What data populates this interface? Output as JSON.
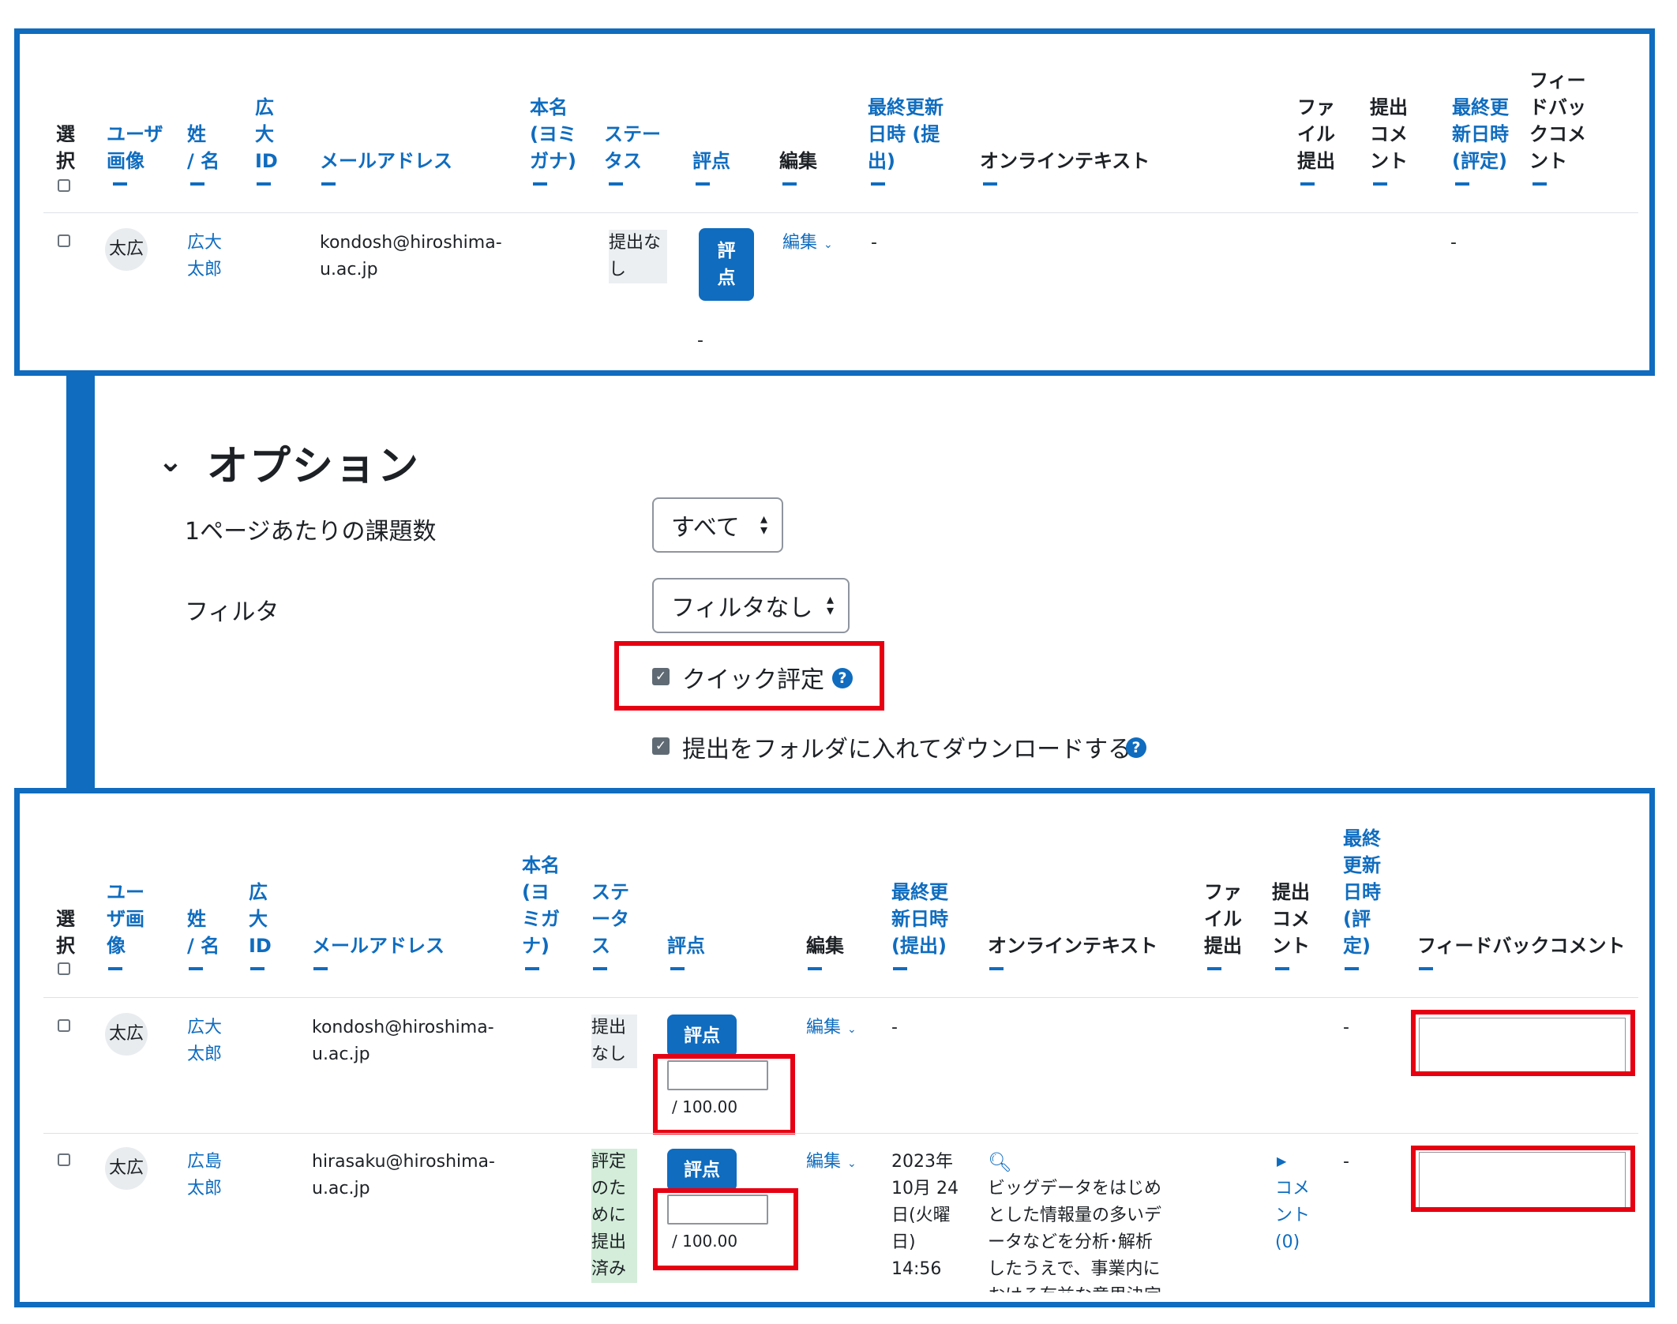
{
  "colors": {
    "frame_blue": "#0f6cbf",
    "highlight_red": "#e60012"
  },
  "top_table": {
    "headers": {
      "select": "選\n択",
      "user_image": "ユーザ\n画像",
      "name": "姓\n/ 名",
      "hiroshima_id": "広\n大\nID",
      "email": "メールアドレス",
      "real_name": "本名\n(ヨミ\nガナ)",
      "status": "ステー\nタス",
      "grade": "評点",
      "edit": "編集",
      "last_modified_submission": "最終更新\n日時 (提\n出)",
      "online_text": "オンラインテキスト",
      "file_submission": "ファ\nイル\n提出",
      "submission_comments": "提出\nコメ\nント",
      "last_modified_grade": "最終更\n新日時\n(評定)",
      "feedback_comment": "フィー\nドバッ\nクコメ\nント"
    },
    "row": {
      "avatar": "太広",
      "name": "広大\n太郎",
      "email": "kondosh@hiroshima-\nu.ac.jp",
      "status": "提出な\nし",
      "grade_button": "評\n点",
      "grade_value": "-",
      "edit": "編集",
      "last_modified": "-",
      "last_modified_grade": "-"
    }
  },
  "options": {
    "title": "オプション",
    "per_page_label": "1ページあたりの課題数",
    "per_page_value": "すべて",
    "filter_label": "フィルタ",
    "filter_value": "フィルタなし",
    "quick_grading_label": "クイック評定",
    "quick_grading_checked": true,
    "download_folders_label": "提出をフォルダに入れてダウンロードする",
    "download_folders_checked": true
  },
  "bottom_table": {
    "headers": {
      "select": "選\n択",
      "user_image": "ユー\nザ画\n像",
      "name": "姓\n/ 名",
      "hiroshima_id": "広\n大\nID",
      "email": "メールアドレス",
      "real_name": "本名\n(ヨ\nミガ\nナ)",
      "status": "ステ\nータ\nス",
      "grade": "評点",
      "edit": "編集",
      "last_modified_submission": "最終更\n新日時\n(提出)",
      "online_text": "オンラインテキスト",
      "file_submission": "ファ\nイル\n提出",
      "submission_comments": "提出\nコメ\nント",
      "last_modified_grade": "最終\n更新\n日時\n(評\n定)",
      "feedback_comment": "フィードバックコメント"
    },
    "rows": [
      {
        "avatar": "太広",
        "name": "広大\n太郎",
        "email": "kondosh@hiroshima-\nu.ac.jp",
        "status": "提出\nなし",
        "grade_button": "評点",
        "grade_max": "/ 100.00",
        "edit": "編集",
        "last_modified": "-",
        "online_text": "",
        "comments": "",
        "last_modified_grade": "-"
      },
      {
        "avatar": "太広",
        "name": "広島\n太郎",
        "email": "hirasaku@hiroshima-\nu.ac.jp",
        "status": "評定\nのた\nめに\n提出\n済み",
        "grade_button": "評点",
        "grade_max": "/ 100.00",
        "edit": "編集",
        "last_modified": "2023年\n10月 24\n日(火曜\n日)\n14:56",
        "online_text": "ビッグデータをはじめ\nとした情報量の多いデ\nータなどを分析･解析\nしたうえで、事業内に\nおける有益な意思決定",
        "comments": "コメ\nント\n(0)",
        "last_modified_grade": "-"
      }
    ]
  }
}
